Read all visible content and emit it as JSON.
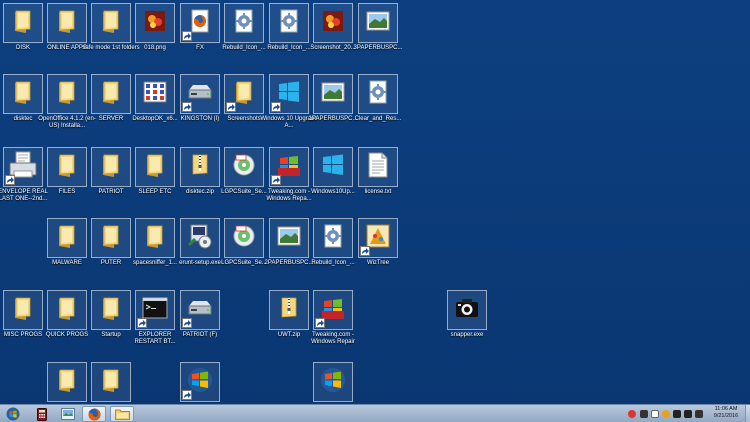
{
  "desktop": {
    "icons": [
      {
        "label": "DISK",
        "icon": "folder-icon",
        "shortcut": false
      },
      {
        "label": "ONLINE APPS",
        "icon": "folder-icon",
        "shortcut": false
      },
      {
        "label": "safe mode 1st folders",
        "icon": "folder-icon",
        "shortcut": false
      },
      {
        "label": "018.png",
        "icon": "image-icon",
        "shortcut": false
      },
      {
        "label": "FX",
        "icon": "firefox-icon",
        "shortcut": true
      },
      {
        "label": "Rebuild_Icon_...",
        "icon": "gear-document-icon",
        "shortcut": false
      },
      {
        "label": "Rebuild_Icon_...",
        "icon": "gear-document-icon",
        "shortcut": false
      },
      {
        "label": "Screenshot_20...",
        "icon": "image-icon",
        "shortcut": false
      },
      {
        "label": "3PAPERBUSPC...",
        "icon": "landscape-image-icon",
        "shortcut": false
      },
      {
        "label": "disktec",
        "icon": "folder-icon",
        "shortcut": false
      },
      {
        "label": "OpenOffice 4.1.2 (en-US) Installa...",
        "icon": "folder-icon",
        "shortcut": false
      },
      {
        "label": "SERVER",
        "icon": "folder-icon",
        "shortcut": false
      },
      {
        "label": "DesktopOK_x6...",
        "icon": "grid-app-icon",
        "shortcut": false
      },
      {
        "label": "KINGSTON (I)",
        "icon": "drive-icon",
        "shortcut": true
      },
      {
        "label": "Screenshots",
        "icon": "folder-icon",
        "shortcut": true
      },
      {
        "label": "Windows 10 Upgrade A...",
        "icon": "windows10-icon",
        "shortcut": true
      },
      {
        "label": "1PAPERBUSPC...",
        "icon": "landscape-image-icon",
        "shortcut": false
      },
      {
        "label": "Clear_and_Res...",
        "icon": "gear-document-icon",
        "shortcut": false
      },
      {
        "label": "ENVELOPE REAL LAST ONE--2nd...",
        "icon": "printer-icon",
        "shortcut": true
      },
      {
        "label": "FILES",
        "icon": "folder-icon",
        "shortcut": false
      },
      {
        "label": "PATRIOT",
        "icon": "folder-icon",
        "shortcut": false
      },
      {
        "label": "SLEEP ETC",
        "icon": "folder-icon",
        "shortcut": false
      },
      {
        "label": "disktec.zip",
        "icon": "zip-folder-icon",
        "shortcut": false
      },
      {
        "label": "LGPCSuite_Se...",
        "icon": "cd-installer-icon",
        "shortcut": false
      },
      {
        "label": "Tweaking.com - Windows Repa...",
        "icon": "windows-repair-icon",
        "shortcut": true
      },
      {
        "label": "Windows10Up...",
        "icon": "windows10-icon",
        "shortcut": false
      },
      {
        "label": "license.txt",
        "icon": "text-document-icon",
        "shortcut": false
      },
      {
        "label": "MALWARE",
        "icon": "folder-icon",
        "shortcut": false
      },
      {
        "label": "PUTER",
        "icon": "folder-icon",
        "shortcut": false
      },
      {
        "label": "spacesniffer_1...",
        "icon": "folder-icon",
        "shortcut": false
      },
      {
        "label": "erunt-setup.exe",
        "icon": "installer-icon",
        "shortcut": false
      },
      {
        "label": "LGPCSuite_Se...",
        "icon": "cd-installer-icon",
        "shortcut": false
      },
      {
        "label": "2PAPERBUSPC...",
        "icon": "landscape-image-icon",
        "shortcut": false
      },
      {
        "label": "Rebuild_Icon_...",
        "icon": "gear-document-icon",
        "shortcut": false
      },
      {
        "label": "WizTree",
        "icon": "wiztree-icon",
        "shortcut": true
      },
      {
        "label": "MISC PROGS",
        "icon": "folder-icon",
        "shortcut": false
      },
      {
        "label": "QUICK PROGS",
        "icon": "folder-icon",
        "shortcut": false
      },
      {
        "label": "Startup",
        "icon": "folder-icon",
        "shortcut": false
      },
      {
        "label": "EXPLORER RESTART BT...",
        "icon": "cmd-icon",
        "shortcut": true
      },
      {
        "label": "PATRIOT (F)",
        "icon": "drive-icon",
        "shortcut": true
      },
      {
        "label": "UWT.zip",
        "icon": "zip-folder-icon",
        "shortcut": false
      },
      {
        "label": "Tweaking.com - Windows Repair",
        "icon": "windows-repair-icon",
        "shortcut": true
      },
      {
        "label": "snapper.exe",
        "icon": "camera-icon",
        "shortcut": false
      },
      {
        "label": "",
        "icon": "folder-icon",
        "shortcut": false
      },
      {
        "label": "",
        "icon": "folder-icon",
        "shortcut": false
      },
      {
        "label": "",
        "icon": "windows7-icon",
        "shortcut": true
      },
      {
        "label": "",
        "icon": "windows7-icon",
        "shortcut": false
      }
    ]
  },
  "taskbar": {
    "start_icon": "windows-start-icon",
    "pinned": [
      {
        "icon": "calculator-icon"
      },
      {
        "icon": "image-viewer-icon"
      },
      {
        "icon": "firefox-icon"
      },
      {
        "icon": "explorer-icon"
      }
    ],
    "tray": {
      "clock_time": "11:06 AM",
      "clock_date": "9/21/2016"
    }
  },
  "colors": {
    "desktop_bg": "#0b3b7a",
    "folder": "#f1cf6a",
    "taskbar": "#a8bbd3"
  }
}
